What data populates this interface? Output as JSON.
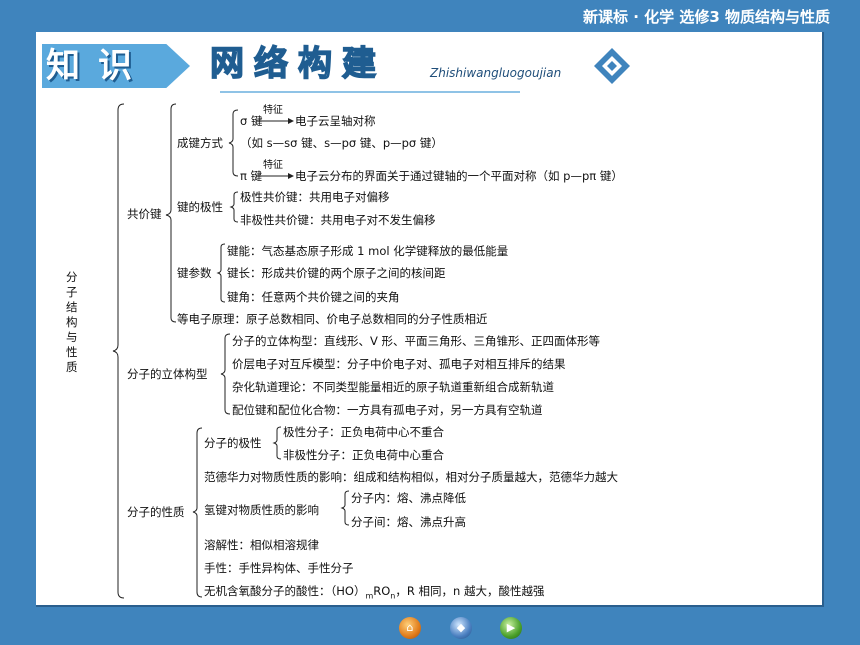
{
  "header": {
    "title": "新课标 · 化学  选修3  物质结构与性质"
  },
  "banner": {
    "zhi": "知识",
    "net": "网络构建",
    "pinyin": "Zhishiwangluogoujian"
  },
  "root": "分子结构与性质",
  "gongjia": {
    "label": "共价键",
    "chengjian": {
      "label": "成键方式",
      "sigma": "σ 键",
      "tezheng1": "特征",
      "sigma_desc": "电子云呈轴对称",
      "sigma_examples": "（如 s—sσ 键、s—pσ 键、p—pσ 键）",
      "pi": "π 键",
      "tezheng2": "特征",
      "pi_desc": "电子云分布的界面关于通过键轴的一个平面对称（如 p—pπ 键）"
    },
    "jixing": {
      "label": "键的极性",
      "polar": "极性共价键：共用电子对偏移",
      "nonpolar": "非极性共价键：共用电子对不发生偏移"
    },
    "canshu": {
      "label": "键参数",
      "jianneng": "键能：气态基态原子形成 1 mol 化学键释放的最低能量",
      "jianchang": "键长：形成共价键的两个原子之间的核间距",
      "jianjiao": "键角：任意两个共价键之间的夹角"
    },
    "dengdianzi": "等电子原理：原子总数相同、价电子总数相同的分子性质相近"
  },
  "liti": {
    "label": "分子的立体构型",
    "items": [
      "分子的立体构型：直线形、V 形、平面三角形、三角锥形、正四面体形等",
      "价层电子对互斥模型：分子中价电子对、孤电子对相互排斥的结果",
      "杂化轨道理论：不同类型能量相近的原子轨道重新组合成新轨道",
      "配位键和配位化合物：一方具有孤电子对，另一方具有空轨道"
    ]
  },
  "xingzhi": {
    "label": "分子的性质",
    "jixing": {
      "label": "分子的极性",
      "polar": "极性分子：正负电荷中心不重合",
      "nonpolar": "非极性分子：正负电荷中心重合"
    },
    "fandehua": "范德华力对物质性质的影响：组成和结构相似，相对分子质量越大，范德华力越大",
    "qingjian": {
      "label": "氢键对物质性质的影响",
      "inner": "分子内：熔、沸点降低",
      "outer": "分子间：熔、沸点升高"
    },
    "rongjie": "溶解性：相似相溶规律",
    "shouxing": "手性：手性异构体、手性分子",
    "suanxing_pre": "无机含氧酸分子的酸性：（HO）",
    "sub_m": "m",
    "ro": "RO",
    "sub_n": "n",
    "suanxing_post": "，R 相同，n 越大，酸性越强"
  },
  "nav": {
    "home": "⌂",
    "mid": "◆",
    "next": "▶"
  }
}
